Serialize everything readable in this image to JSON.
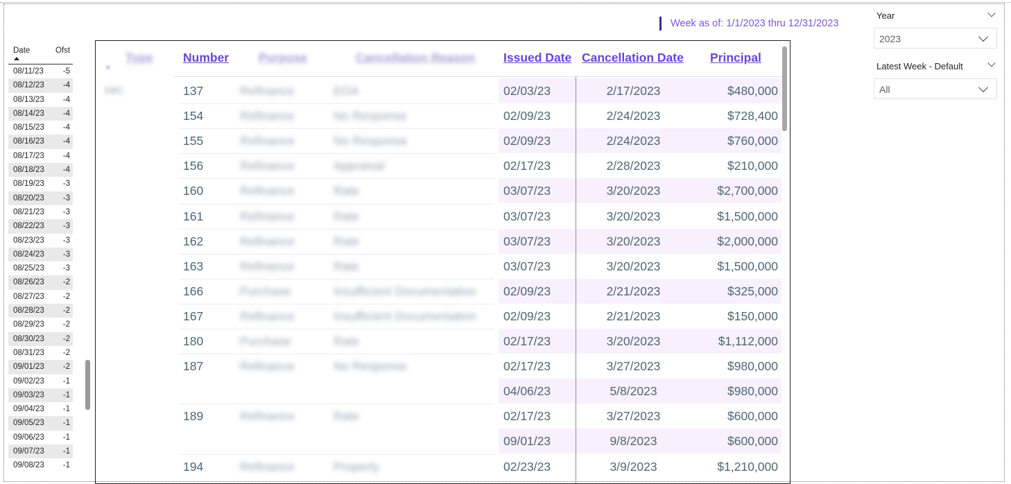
{
  "header": {
    "week_range": "Week as of: 1/1/2023 thru 12/31/2023"
  },
  "date_list": {
    "col_date": "Date",
    "col_ofst": "Ofst",
    "rows": [
      {
        "date": "08/11/23",
        "ofst": "-5"
      },
      {
        "date": "08/12/23",
        "ofst": "-4"
      },
      {
        "date": "08/13/23",
        "ofst": "-4"
      },
      {
        "date": "08/14/23",
        "ofst": "-4"
      },
      {
        "date": "08/15/23",
        "ofst": "-4"
      },
      {
        "date": "08/16/23",
        "ofst": "-4"
      },
      {
        "date": "08/17/23",
        "ofst": "-4"
      },
      {
        "date": "08/18/23",
        "ofst": "-4"
      },
      {
        "date": "08/19/23",
        "ofst": "-3"
      },
      {
        "date": "08/20/23",
        "ofst": "-3"
      },
      {
        "date": "08/21/23",
        "ofst": "-3"
      },
      {
        "date": "08/22/23",
        "ofst": "-3"
      },
      {
        "date": "08/23/23",
        "ofst": "-3"
      },
      {
        "date": "08/24/23",
        "ofst": "-3"
      },
      {
        "date": "08/25/23",
        "ofst": "-3"
      },
      {
        "date": "08/26/23",
        "ofst": "-2"
      },
      {
        "date": "08/27/23",
        "ofst": "-2"
      },
      {
        "date": "08/28/23",
        "ofst": "-2"
      },
      {
        "date": "08/29/23",
        "ofst": "-2"
      },
      {
        "date": "08/30/23",
        "ofst": "-2"
      },
      {
        "date": "08/31/23",
        "ofst": "-2"
      },
      {
        "date": "09/01/23",
        "ofst": "-2"
      },
      {
        "date": "09/02/23",
        "ofst": "-1"
      },
      {
        "date": "09/03/23",
        "ofst": "-1"
      },
      {
        "date": "09/04/23",
        "ofst": "-1"
      },
      {
        "date": "09/05/23",
        "ofst": "-1"
      },
      {
        "date": "09/06/23",
        "ofst": "-1"
      },
      {
        "date": "09/07/23",
        "ofst": "-1"
      },
      {
        "date": "09/08/23",
        "ofst": "-1"
      }
    ]
  },
  "table": {
    "headers": {
      "type": "Type",
      "number": "Number",
      "purpose": "Purpose",
      "reason": "Cancellation Reason",
      "issued": "Issued Date",
      "cancel": "Cancellation Date",
      "principal": "Principal"
    },
    "type_value": "SBC",
    "rows": [
      {
        "number": "137",
        "purpose": "Refinance",
        "reason": "EOA",
        "issued": "02/03/23",
        "cancel": "2/17/2023",
        "principal": "$480,000"
      },
      {
        "number": "154",
        "purpose": "Refinance",
        "reason": "No Response",
        "issued": "02/09/23",
        "cancel": "2/24/2023",
        "principal": "$728,400"
      },
      {
        "number": "155",
        "purpose": "Refinance",
        "reason": "No Response",
        "issued": "02/09/23",
        "cancel": "2/24/2023",
        "principal": "$760,000"
      },
      {
        "number": "156",
        "purpose": "Refinance",
        "reason": "Appraisal",
        "issued": "02/17/23",
        "cancel": "2/28/2023",
        "principal": "$210,000"
      },
      {
        "number": "160",
        "purpose": "Refinance",
        "reason": "Rate",
        "issued": "03/07/23",
        "cancel": "3/20/2023",
        "principal": "$2,700,000"
      },
      {
        "number": "161",
        "purpose": "Refinance",
        "reason": "Rate",
        "issued": "03/07/23",
        "cancel": "3/20/2023",
        "principal": "$1,500,000"
      },
      {
        "number": "162",
        "purpose": "Refinance",
        "reason": "Rate",
        "issued": "03/07/23",
        "cancel": "3/20/2023",
        "principal": "$2,000,000"
      },
      {
        "number": "163",
        "purpose": "Refinance",
        "reason": "Rate",
        "issued": "03/07/23",
        "cancel": "3/20/2023",
        "principal": "$1,500,000"
      },
      {
        "number": "166",
        "purpose": "Purchase",
        "reason": "Insufficient Documentation",
        "issued": "02/09/23",
        "cancel": "2/21/2023",
        "principal": "$325,000"
      },
      {
        "number": "167",
        "purpose": "Refinance",
        "reason": "Insufficient Documentation",
        "issued": "02/09/23",
        "cancel": "2/21/2023",
        "principal": "$150,000"
      },
      {
        "number": "180",
        "purpose": "Purchase",
        "reason": "Rate",
        "issued": "02/17/23",
        "cancel": "3/20/2023",
        "principal": "$1,112,000"
      },
      {
        "number": "187",
        "purpose": "Refinance",
        "reason": "No Response",
        "issued": "02/17/23",
        "cancel": "3/27/2023",
        "principal": "$980,000"
      },
      {
        "number": "",
        "purpose": "",
        "reason": "",
        "issued": "04/06/23",
        "cancel": "5/8/2023",
        "principal": "$980,000"
      },
      {
        "number": "189",
        "purpose": "Refinance",
        "reason": "Rate",
        "issued": "02/17/23",
        "cancel": "3/27/2023",
        "principal": "$600,000"
      },
      {
        "number": "",
        "purpose": "",
        "reason": "",
        "issued": "09/01/23",
        "cancel": "9/8/2023",
        "principal": "$600,000"
      },
      {
        "number": "194",
        "purpose": "Refinance",
        "reason": "Property",
        "issued": "02/23/23",
        "cancel": "3/9/2023",
        "principal": "$1,210,000"
      }
    ]
  },
  "slicers": {
    "year_title": "Year",
    "year_value": "2023",
    "week_title": "Latest Week - Default",
    "week_value": "All"
  }
}
